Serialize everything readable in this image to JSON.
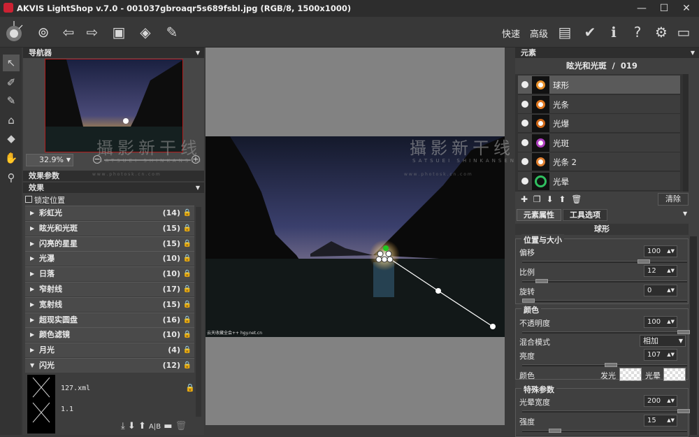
{
  "window": {
    "title": "AKVIS LightShop v.7.0 - 001037gbroaqr5s689fsbl.jpg (RGB/8, 1500x1000)"
  },
  "toolbar": {
    "mode_express": "快速",
    "mode_advanced": "高级"
  },
  "icons": [
    "app-icon",
    "open-icon",
    "save-icon",
    "back-icon",
    "forward-icon",
    "run-icon",
    "batch-icon",
    "share-icon",
    "layout-icon",
    "apply-icon",
    "info-icon",
    "help-icon",
    "settings-icon",
    "message-icon",
    "select-tool-icon",
    "brush-icon",
    "eraser-icon",
    "stamp-icon",
    "tag-icon",
    "hand-icon",
    "zoom-icon"
  ],
  "navigator": {
    "title": "导航器",
    "zoom": "32.9%"
  },
  "effects": {
    "params_title": "效果参数",
    "effects_title": "效果",
    "lock_position": "锁定位置",
    "categories": [
      {
        "name": "彩虹光",
        "count": "(14)"
      },
      {
        "name": "眩光和光斑",
        "count": "(15)"
      },
      {
        "name": "闪亮的星星",
        "count": "(15)"
      },
      {
        "name": "光瀑",
        "count": "(10)"
      },
      {
        "name": "日落",
        "count": "(10)"
      },
      {
        "name": "窄射线",
        "count": "(17)"
      },
      {
        "name": "宽射线",
        "count": "(15)"
      },
      {
        "name": "超现实圆盘",
        "count": "(16)"
      },
      {
        "name": "颜色滤镜",
        "count": "(10)"
      },
      {
        "name": "月光",
        "count": "(4)"
      },
      {
        "name": "闪光",
        "count": "(12)"
      }
    ],
    "presets": [
      "127.xml",
      "1.1"
    ]
  },
  "watermark": {
    "text": "攝影新干线",
    "sub": "SATSUEI SHINKANSEN",
    "url": "w w w . p h o t o s k . c n . c o m"
  },
  "photo": {
    "caption": "云天收藏全会++ hgy.net.cn"
  },
  "elements": {
    "title": "元素",
    "preset_name": "眩光和光斑  /  019",
    "items": [
      {
        "name": "球形",
        "selected": true
      },
      {
        "name": "光条",
        "selected": false
      },
      {
        "name": "光爆",
        "selected": false
      },
      {
        "name": "光斑",
        "selected": false
      },
      {
        "name": "光条 2",
        "selected": false
      },
      {
        "name": "光晕",
        "selected": false
      }
    ],
    "clear": "清除"
  },
  "props": {
    "tab_props": "元素属性",
    "tab_tools": "工具选项",
    "element_name": "球形",
    "group_pos": "位置与大小",
    "offset_label": "偏移",
    "offset": "100",
    "scale_label": "比例",
    "scale": "12",
    "rotate_label": "旋转",
    "rotate": "0",
    "group_color": "颜色",
    "opacity_label": "不透明度",
    "opacity": "100",
    "blend_label": "混合模式",
    "blend": "相加",
    "brightness_label": "亮度",
    "brightness": "107",
    "color_label": "颜色",
    "glow_label": "发光",
    "halo_label": "光晕",
    "group_special": "特殊参数",
    "halo_width_label": "光晕宽度",
    "halo_width": "200",
    "strength_label": "强度",
    "strength": "15"
  }
}
